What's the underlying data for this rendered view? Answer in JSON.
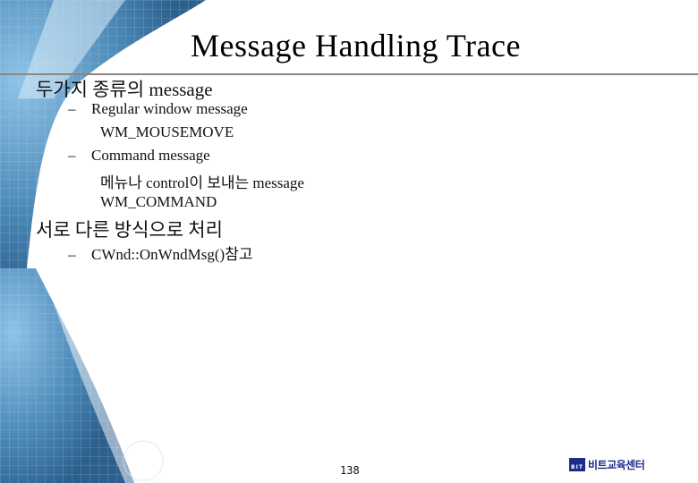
{
  "slide": {
    "title": "Message Handling Trace",
    "content": [
      {
        "level": 1,
        "text": "두가지 종류의 message"
      },
      {
        "level": 2,
        "bullet": "–",
        "text": "Regular window message"
      },
      {
        "level": 3,
        "text": "WM_MOUSEMOVE"
      },
      {
        "level": 2,
        "bullet": "–",
        "text": "Command message"
      },
      {
        "level": 3,
        "text": "메뉴나 control이 보내는 message"
      },
      {
        "level": 3,
        "text": "WM_COMMAND"
      },
      {
        "level": 1,
        "text": "서로 다른 방식으로 처리"
      },
      {
        "level": 2,
        "bullet": "–",
        "text": "CWnd::OnWndMsg()참고"
      }
    ],
    "page_number": "138"
  },
  "footer": {
    "logo_mark": "BIT",
    "logo_text": "비트교육센터",
    "brand_color": "#1c2c8a"
  },
  "theme": {
    "accent": "#3a78a8",
    "divider_color": "#888888"
  }
}
